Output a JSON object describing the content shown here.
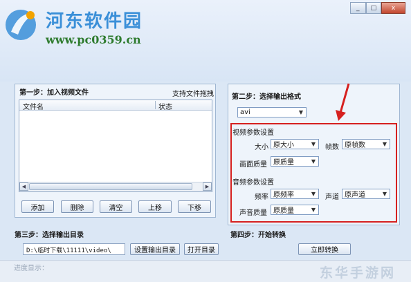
{
  "logo": {
    "brand": "河东软件园",
    "url": "www.pc0359.cn"
  },
  "window_controls": {
    "minimize": "_",
    "maximize": "□",
    "close": "x"
  },
  "step1": {
    "title": "第一步：加入视频文件",
    "support_drag": "支持文件拖拽",
    "columns": [
      "文件名",
      "状态"
    ],
    "buttons": {
      "add": "添加",
      "delete": "删除",
      "clear": "清空",
      "up": "上移",
      "down": "下移"
    }
  },
  "step2": {
    "title": "第二步：选择输出格式",
    "format": "avi",
    "video": {
      "title": "视频参数设置",
      "size_label": "大小",
      "size_value": "原大小",
      "fps_label": "帧数",
      "fps_value": "原帧数",
      "quality_label": "画面质量",
      "quality_value": "原质量"
    },
    "audio": {
      "title": "音频参数设置",
      "freq_label": "频率",
      "freq_value": "原频率",
      "channel_label": "声道",
      "channel_value": "原声道",
      "quality_label": "声音质量",
      "quality_value": "原质量"
    }
  },
  "step3": {
    "title": "第三步：选择输出目录",
    "path": "D:\\临时下载\\11111\\video\\",
    "set_button": "设置输出目录",
    "open_button": "打开目录"
  },
  "step4": {
    "title": "第四步：开始转换",
    "convert_button": "立即转换"
  },
  "status": {
    "progress_label": "进度显示：",
    "watermark": "东华手游网"
  },
  "colors": {
    "highlight_box": "#d6201f",
    "arrow": "#d6201f",
    "brand_blue": "#3a8fd8",
    "url_green": "#2e7b2e"
  },
  "icons": {
    "dropdown": "chevron-down-icon",
    "scroll_left": "arrow-left-icon",
    "scroll_right": "arrow-right-icon"
  }
}
